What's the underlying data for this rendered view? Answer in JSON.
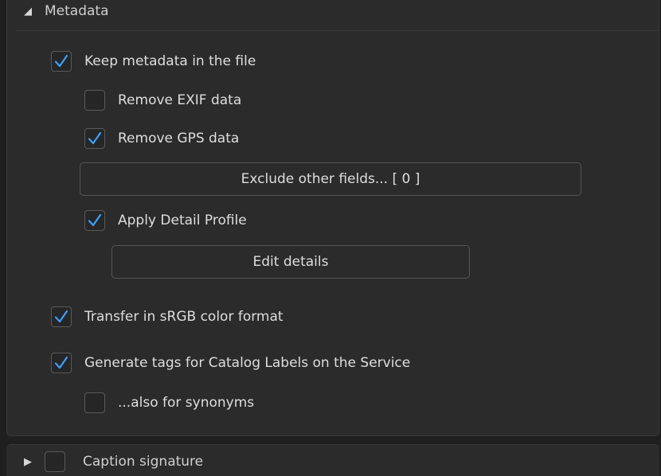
{
  "metadata_section": {
    "title": "Metadata",
    "expand_icon": "triangle-down-icon",
    "options": {
      "keep_metadata": {
        "label": "Keep metadata in the file",
        "checked": true
      },
      "remove_exif": {
        "label": "Remove EXIF data",
        "checked": false
      },
      "remove_gps": {
        "label": "Remove GPS data",
        "checked": true
      },
      "apply_detail_profile": {
        "label": "Apply Detail Profile",
        "checked": true
      },
      "transfer_srgb": {
        "label": "Transfer in sRGB color format",
        "checked": true
      },
      "generate_tags": {
        "label": "Generate tags for Catalog Labels on the Service",
        "checked": true
      },
      "also_synonyms": {
        "label": "...also for synonyms",
        "checked": false
      }
    },
    "exclude_button_label": "Exclude other fields... [ 0 ]",
    "edit_details_button_label": "Edit details"
  },
  "caption_section": {
    "title": "Caption signature",
    "expand_icon": "triangle-right-icon",
    "checked": false
  },
  "colors": {
    "accent_check": "#3aa0ff",
    "panel_bg": "#2b2b2b",
    "page_bg": "#1f1f1f"
  }
}
